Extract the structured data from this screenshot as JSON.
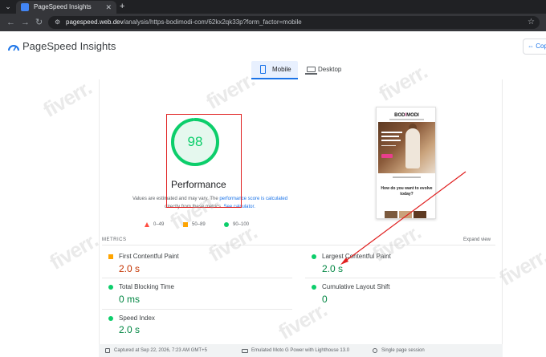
{
  "browser": {
    "tab_title": "PageSpeed Insights",
    "tab_close": "✕",
    "new_tab": "+",
    "url_host": "pagespeed.web.dev",
    "url_path": "/analysis/https-bodimodi-com/62kx2qk33p?form_factor=mobile"
  },
  "header": {
    "app_title": "PageSpeed Insights",
    "copy_link_label": "Cop"
  },
  "device_tabs": {
    "mobile_label": "Mobile",
    "desktop_label": "Desktop",
    "selected": "Mobile"
  },
  "score": {
    "value": "98",
    "value_fraction": 0.98,
    "label": "Performance",
    "color": "#0cce6b"
  },
  "disclaimer": {
    "prefix": "Values are estimated and may vary. The ",
    "link": "performance score is calculated",
    "line2": "directly from these metrics.",
    "line2_link": "See calculator."
  },
  "legend": [
    {
      "range": "0–49",
      "shape": "triangle",
      "color": "#ff4e42"
    },
    {
      "range": "50–89",
      "shape": "square",
      "color": "#ffa400"
    },
    {
      "range": "90–100",
      "shape": "circle",
      "color": "#0cce6b"
    }
  ],
  "preview": {
    "brand_a": "BOD",
    "brand_b": "I",
    "brand_c": "MODI",
    "question": "How do you want to evolve today?"
  },
  "metrics": {
    "title": "METRICS",
    "expand": "Expand view",
    "items": [
      {
        "name": "First Contentful Paint",
        "value": "2.0 s",
        "status": "orange"
      },
      {
        "name": "Largest Contentful Paint",
        "value": "2.0 s",
        "status": "green"
      },
      {
        "name": "Total Blocking Time",
        "value": "0 ms",
        "status": "green"
      },
      {
        "name": "Cumulative Layout Shift",
        "value": "0",
        "status": "green"
      },
      {
        "name": "Speed Index",
        "value": "2.0 s",
        "status": "green"
      }
    ]
  },
  "footer": {
    "captured": "Captured at Sep 22, 2026, 7:23 AM GMT+5",
    "device": "Emulated Moto G Power with Lighthouse 13.0",
    "session": "Single page session"
  },
  "watermark": "fiverr."
}
